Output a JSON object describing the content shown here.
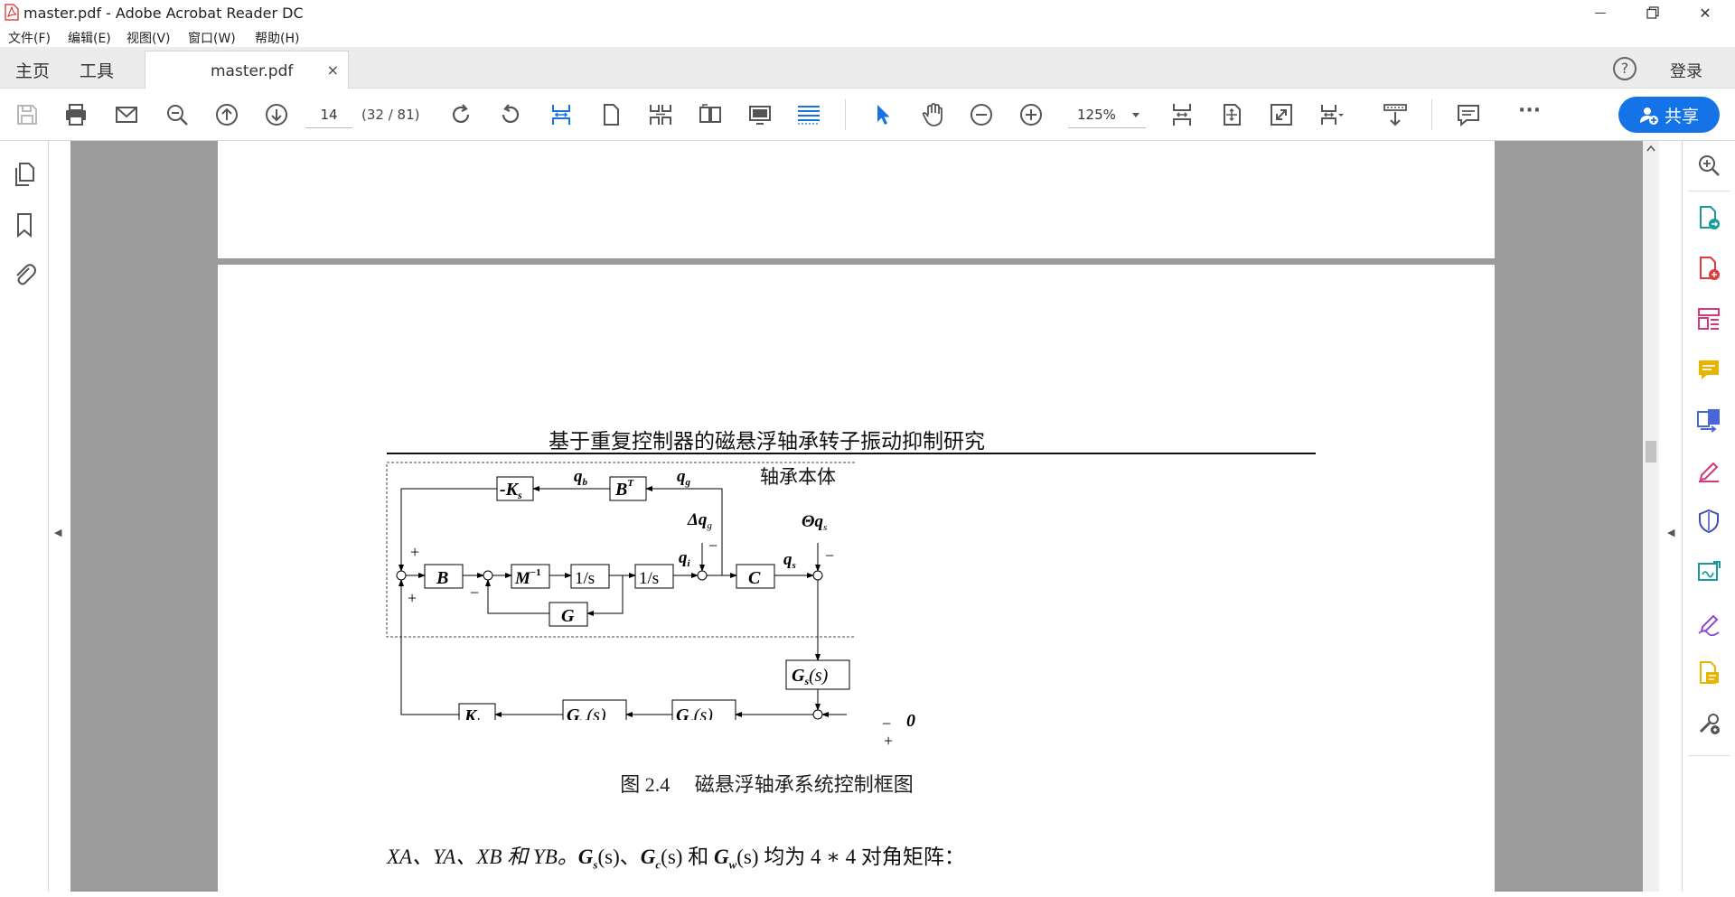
{
  "window": {
    "title": "master.pdf - Adobe Acrobat Reader DC",
    "minimize_glyph": "—",
    "close_glyph": "✕"
  },
  "menu": {
    "items": [
      "文件(F)",
      "编辑(E)",
      "视图(V)",
      "窗口(W)",
      "帮助(H)"
    ]
  },
  "tabs": {
    "home": "主页",
    "tools": "工具",
    "doc_name": "master.pdf",
    "close_glyph": "×",
    "help_glyph": "?",
    "login": "登录"
  },
  "toolbar": {
    "page_current": "14",
    "page_info": "(32 / 81)",
    "zoom": "125%",
    "share_label": "共享",
    "more_glyph": "···",
    "icons": [
      "save-icon",
      "print-icon",
      "email-icon",
      "search-zoom-icon",
      "page-up-icon",
      "page-down-icon",
      "rotate-cw-icon",
      "rotate-ccw-icon",
      "fit-width-icon",
      "single-page-icon",
      "two-page-scroll-icon",
      "two-page-icon",
      "presentation-icon",
      "read-mode-icon",
      "select-cursor-icon",
      "hand-tool-icon",
      "zoom-out-icon",
      "zoom-in-icon",
      "fit-page-icon",
      "fit-visible-icon",
      "fullscreen-icon",
      "scroll-mode-icon",
      "download-icon",
      "comment-icon"
    ]
  },
  "left_panel": {
    "icons": [
      "page-thumbnails-icon",
      "bookmarks-icon",
      "attachments-icon"
    ],
    "collapse_glyph": "◀"
  },
  "right_panel": {
    "expand_glyph": "◀",
    "icons": [
      "search-panel-icon",
      "export-pdf-icon",
      "create-pdf-icon",
      "edit-pdf-icon",
      "comment-tool-icon",
      "combine-files-icon",
      "fill-sign-icon",
      "protect-icon",
      "send-for-signature-icon",
      "signature-icon",
      "stamp-icon",
      "more-tools-icon"
    ],
    "colors": {
      "teal": "#1a9a9a",
      "red": "#e03a3a",
      "pink": "#d6367a",
      "yellow": "#e8b400",
      "blue": "#4a66d6",
      "purple": "#8a4ad6",
      "navy": "#3c50b4"
    }
  },
  "document": {
    "header": "基于重复控制器的磁悬浮轴承转子振动抑制研究",
    "figure_caption": "图 2.4　 磁悬浮轴承系统控制框图",
    "diagram": {
      "region_label": "轴承本体",
      "blocks": {
        "neg_ks": "-K",
        "neg_ks_sub": "s",
        "bt": "B",
        "bt_sup": "T",
        "b": "B",
        "minv": "M",
        "minv_sup": "−1",
        "int1": "1/s",
        "int2": "1/s",
        "g": "G",
        "c": "C",
        "gs": "G",
        "gs_sub": "s",
        "gs_arg": "(s)",
        "gc": "G",
        "gc_sub": "c",
        "gc_arg": "(s)",
        "gw": "G",
        "gw_sub": "w",
        "gw_arg": "(s)",
        "ki": "K",
        "ki_sub": "i"
      },
      "signals": {
        "qb": "q",
        "qb_sub": "b",
        "qg": "q",
        "qg_sub": "g",
        "dqg": "Δq",
        "dqg_sub": "g",
        "theta_qs": "Θq",
        "theta_qs_sub": "s",
        "qi": "q",
        "qi_sub": "i",
        "qs": "q",
        "qs_sub": "s",
        "zero": "0"
      },
      "signs": {
        "plus": "+",
        "minus": "−"
      }
    },
    "body_line": {
      "prefix": "XA、YA、XB 和 YB。",
      "g1": "G",
      "g1_sub": "s",
      "arg": "(s)",
      "sep": "、",
      "g2": "G",
      "g2_sub": "c",
      "and": " 和 ",
      "g3": "G",
      "g3_sub": "w",
      "suffix": " 均为 4 ∗ 4 对角矩阵："
    }
  }
}
